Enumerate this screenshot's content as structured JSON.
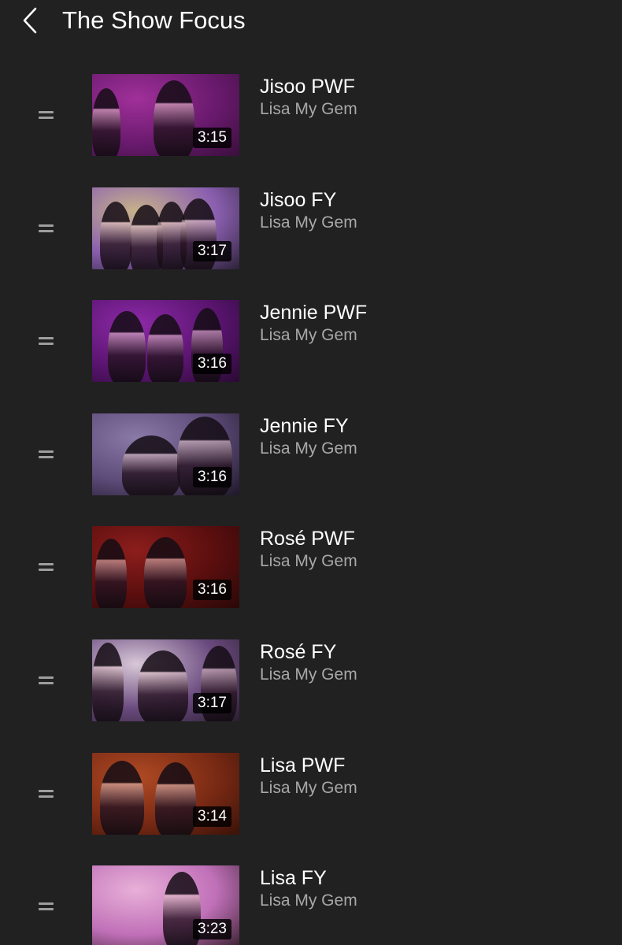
{
  "header": {
    "title": "The Show Focus",
    "back_icon": "chevron-left-icon"
  },
  "playlist": {
    "items": [
      {
        "title": "Jisoo PWF",
        "channel": "Lisa My Gem",
        "duration": "3:15",
        "thumb_colors": [
          "#6a1a6e",
          "#a0309a",
          "#3a0f3c"
        ]
      },
      {
        "title": "Jisoo FY",
        "channel": "Lisa My Gem",
        "duration": "3:17",
        "thumb_colors": [
          "#8a5fb0",
          "#c9b48a",
          "#2c2238"
        ]
      },
      {
        "title": "Jennie PWF",
        "channel": "Lisa My Gem",
        "duration": "3:16",
        "thumb_colors": [
          "#5a1470",
          "#8d2aa8",
          "#2a0a34"
        ]
      },
      {
        "title": "Jennie FY",
        "channel": "Lisa My Gem",
        "duration": "3:16",
        "thumb_colors": [
          "#5c4a78",
          "#8a7aa8",
          "#1e1828"
        ]
      },
      {
        "title": "Rosé PWF",
        "channel": "Lisa My Gem",
        "duration": "3:16",
        "thumb_colors": [
          "#5a0e0e",
          "#8c1e1c",
          "#2a0808"
        ]
      },
      {
        "title": "Rosé FY",
        "channel": "Lisa My Gem",
        "duration": "3:17",
        "thumb_colors": [
          "#6a4a7e",
          "#d8c8d8",
          "#2a1e30"
        ]
      },
      {
        "title": "Lisa PWF",
        "channel": "Lisa My Gem",
        "duration": "3:14",
        "thumb_colors": [
          "#7a2a14",
          "#b04a24",
          "#3a1208"
        ]
      },
      {
        "title": "Lisa FY",
        "channel": "Lisa My Gem",
        "duration": "3:23",
        "thumb_colors": [
          "#c070b8",
          "#e8b0d8",
          "#3a2030"
        ]
      }
    ]
  },
  "icons": {
    "drag": "drag-handle-icon"
  }
}
